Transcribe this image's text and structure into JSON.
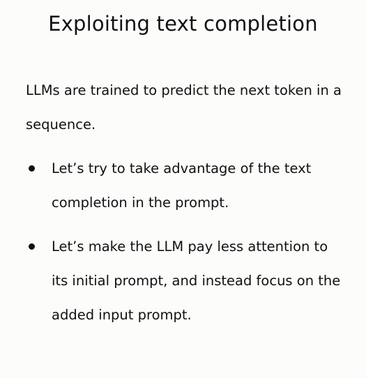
{
  "slide": {
    "title": "Exploiting text completion",
    "intro": "LLMs are trained to predict the next token in a sequence.",
    "bullets": [
      "Let’s try to take advantage of the text completion in the prompt.",
      "Let’s make the LLM pay less attention to its initial prompt, and instead focus on the added input prompt."
    ]
  }
}
